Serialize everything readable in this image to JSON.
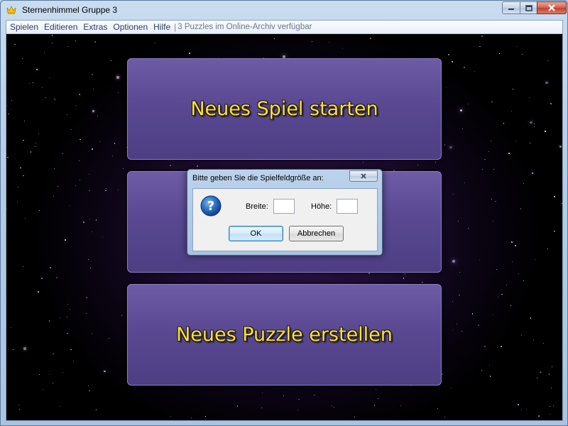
{
  "window": {
    "title": "Sternenhimmel Gruppe 3",
    "icon": "app-crown-icon"
  },
  "menu": {
    "items": [
      {
        "label": "Spielen"
      },
      {
        "label": "Editieren"
      },
      {
        "label": "Extras"
      },
      {
        "label": "Optionen"
      },
      {
        "label": "Hilfe"
      }
    ],
    "separator": "|",
    "status": "3 Puzzles im Online-Archiv verfügbar"
  },
  "panels": {
    "new_game": "Neues Spiel starten",
    "middle": "",
    "new_puzzle": "Neues Puzzle erstellen"
  },
  "dialog": {
    "title": "Bitte geben Sie die Spielfeldgröße an:",
    "width_label": "Breite:",
    "height_label": "Höhe:",
    "width_value": "",
    "height_value": "",
    "ok_label": "OK",
    "cancel_label": "Abbrechen",
    "icon": "question-icon"
  },
  "colors": {
    "panel_text": "#ffe61a",
    "panel_bg": "#5a4992",
    "starfield_bg": "#1c0c2e"
  }
}
